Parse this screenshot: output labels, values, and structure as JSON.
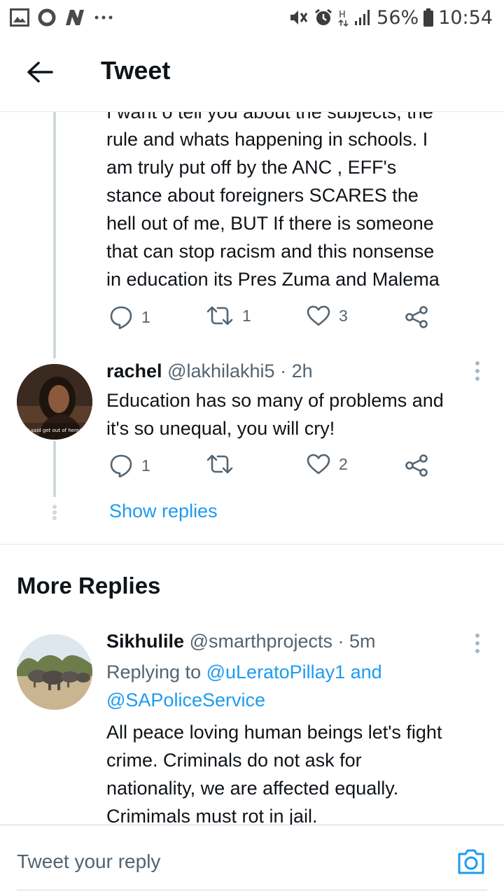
{
  "status_bar": {
    "battery": "56%",
    "time": "10:54",
    "left_icons": [
      "gallery-icon",
      "o-app-icon",
      "n-app-icon",
      "more-dots-icon"
    ],
    "right_icons": [
      "mute-vibrate-icon",
      "alarm-icon",
      "hplus-icon",
      "signal-icon",
      "battery-icon"
    ]
  },
  "header": {
    "title": "Tweet"
  },
  "thread_tweet": {
    "partial_first_line": "I want o tell you about the subjects, the",
    "lines": [
      "rule and whats happening in schools. I",
      "am truly put off by the ANC , EFF's",
      "stance about foreigners SCARES the",
      "hell out of me, BUT If there is someone",
      "that can stop racism and this nonsense",
      "in education its Pres Zuma and Malema"
    ],
    "reply_count": "1",
    "retweet_count": "1",
    "like_count": "3"
  },
  "rachel_tweet": {
    "name": "rachel",
    "handle": "@lakhilakhi5",
    "time": "· 2h",
    "avatar_caption": "I said get out of here!",
    "text_lines": [
      "Education has so many of problems and",
      "it's so unequal, you will cry!"
    ],
    "reply_count": "1",
    "retweet_count": "",
    "like_count": "2"
  },
  "show_replies": "Show replies",
  "more_replies": {
    "title": "More Replies"
  },
  "sikhulile_tweet": {
    "name": "Sikhulile",
    "handle": "@smarthprojects",
    "time": "· 5m",
    "replying_prefix": "Replying to",
    "replying_users_line1": "@uLeratoPillay1 and",
    "replying_users_line2": "@SAPoliceService",
    "text_lines": [
      "All peace loving human beings let's fight",
      "crime. Criminals do not ask for",
      "nationality, we are affected equally.",
      "Crimimals must rot in jail."
    ]
  },
  "reply_bar": {
    "placeholder": "Tweet your reply"
  },
  "colors": {
    "accent": "#1d9bf0",
    "secondary_text": "#536471",
    "thread_line": "#cfd9de"
  }
}
